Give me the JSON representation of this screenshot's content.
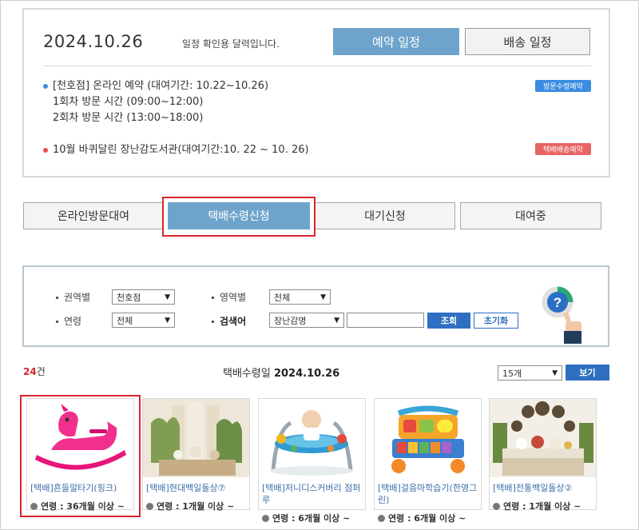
{
  "schedule": {
    "date": "2024.10.26",
    "calendar_note": "일정 확인용 달력입니다.",
    "btn_reservation": "예약 일정",
    "btn_delivery": "배송 일정",
    "events": [
      {
        "lines": [
          "[천호점] 온라인 예약 (대여기간: 10.22~10.26)",
          "1회차 방문 시간 (09:00~12:00)",
          "2회차 방문 시간 (13:00~18:00)"
        ],
        "tag": "방문수령예약",
        "dot_color": "#3a8de0",
        "tag_color": "#3a8de0"
      },
      {
        "lines": [
          "10월 바퀴달린 장난감도서관(대여기간:10. 22 ~ 10. 26)"
        ],
        "tag": "택배배송예약",
        "dot_color": "#e2504c",
        "tag_color": "#e86464"
      }
    ]
  },
  "tabs": [
    {
      "label": "온라인방문대여"
    },
    {
      "label": "택배수령신청"
    },
    {
      "label": "대기신청"
    },
    {
      "label": "대여중"
    }
  ],
  "search": {
    "region_label": "권역별",
    "region_value": "천호점",
    "area_label": "영역별",
    "area_value": "전체",
    "age_label": "연령",
    "age_value": "전체",
    "keyword_label": "검색어",
    "keyword_type": "장난감명",
    "keyword_value": "",
    "btn_search": "조회",
    "btn_reset": "초기화"
  },
  "results": {
    "count": "24",
    "count_unit": "건",
    "pickup_label": "택배수령일",
    "pickup_date": "2024.10.26",
    "page_size": "15개",
    "btn_view": "보기"
  },
  "products": [
    {
      "name": "[택배]흔들말타기(핑크)",
      "age": "연령 : 36개월 이상 ~"
    },
    {
      "name": "[택배]현대백일돌상⑦",
      "age": "연령 : 1개월 이상 ~"
    },
    {
      "name": "[택배]저니디스커버리 점퍼루",
      "age": "연령 : 6개월 이상 ~"
    },
    {
      "name": "[택배]걸음마학습기(한영그린)",
      "age": "연령 : 6개월 이상 ~"
    },
    {
      "name": "[택배]전통백일돌상②",
      "age": "연령 : 1개월 이상 ~"
    }
  ],
  "colors": {
    "accent": "#6ea4cb",
    "highlight": "#d9262a",
    "search_btn": "#2f6fc1",
    "link": "#3a6fa8"
  }
}
